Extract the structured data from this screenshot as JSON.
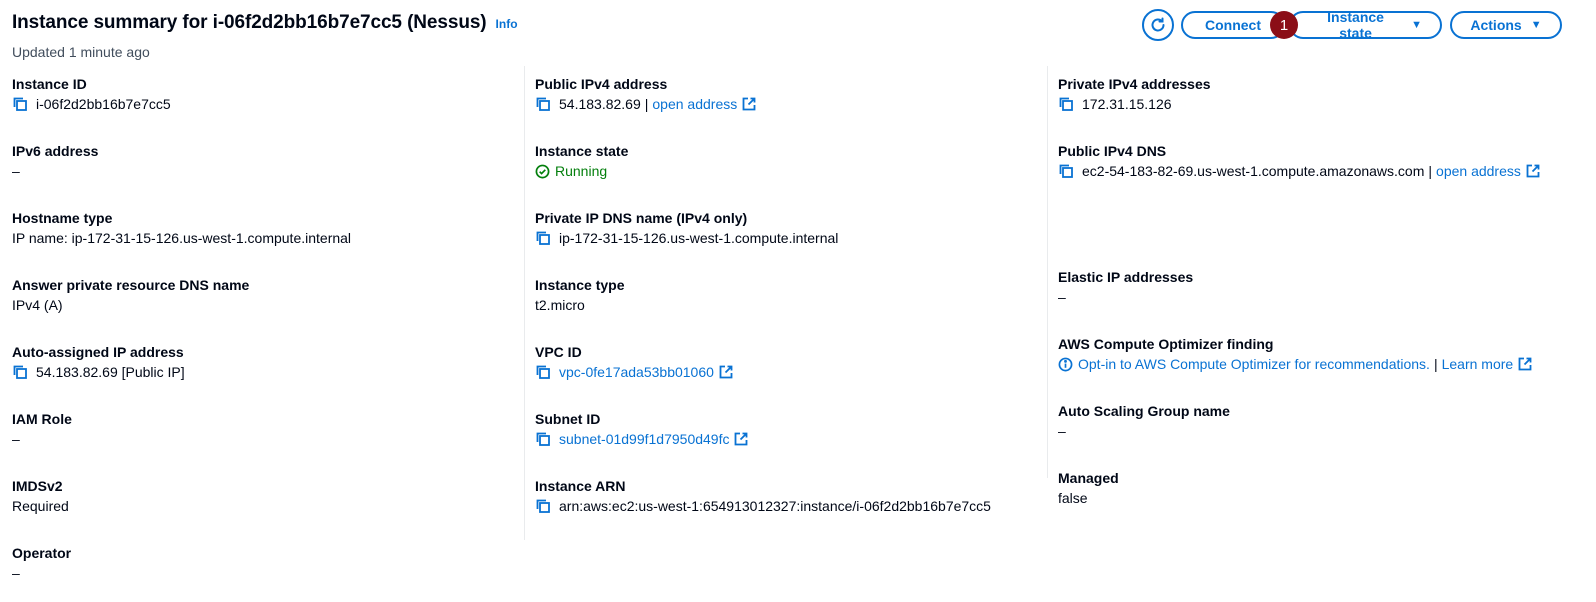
{
  "header": {
    "title": "Instance summary for i-06f2d2bb16b7e7cc5 (Nessus)",
    "info_label": "Info",
    "updated": "Updated 1 minute ago"
  },
  "buttons": {
    "refresh_icon": "refresh-icon",
    "connect": "Connect",
    "badge": "1",
    "instance_state": "Instance state",
    "actions": "Actions"
  },
  "col1": {
    "instance_id_label": "Instance ID",
    "instance_id": "i-06f2d2bb16b7e7cc5",
    "ipv6_label": "IPv6 address",
    "ipv6": "–",
    "hostname_type_label": "Hostname type",
    "hostname_type": "IP name: ip-172-31-15-126.us-west-1.compute.internal",
    "answer_dns_label": "Answer private resource DNS name",
    "answer_dns": "IPv4 (A)",
    "auto_ip_label": "Auto-assigned IP address",
    "auto_ip": "54.183.82.69 [Public IP]",
    "iam_label": "IAM Role",
    "iam": "–",
    "imds_label": "IMDSv2",
    "imds": "Required",
    "operator_label": "Operator",
    "operator": "–"
  },
  "col2": {
    "public_ip_label": "Public IPv4 address",
    "public_ip": "54.183.82.69",
    "pipe": "|",
    "open_address": "open address",
    "state_label": "Instance state",
    "state": "Running",
    "private_dns_label": "Private IP DNS name (IPv4 only)",
    "private_dns": "ip-172-31-15-126.us-west-1.compute.internal",
    "type_label": "Instance type",
    "type": "t2.micro",
    "vpc_label": "VPC ID",
    "vpc": "vpc-0fe17ada53bb01060",
    "subnet_label": "Subnet ID",
    "subnet": "subnet-01d99f1d7950d49fc",
    "arn_label": "Instance ARN",
    "arn": "arn:aws:ec2:us-west-1:654913012327:instance/i-06f2d2bb16b7e7cc5"
  },
  "col3": {
    "private_ip_label": "Private IPv4 addresses",
    "private_ip": "172.31.15.126",
    "public_dns_label": "Public IPv4 DNS",
    "public_dns": "ec2-54-183-82-69.us-west-1.compute.amazonaws.com",
    "pipe": "|",
    "open_address": "open address",
    "elastic_label": "Elastic IP addresses",
    "elastic": "–",
    "optimizer_label": "AWS Compute Optimizer finding",
    "optimizer_link": "Opt-in to AWS Compute Optimizer for recommendations.",
    "learn_more": "Learn more",
    "asg_label": "Auto Scaling Group name",
    "asg": "–",
    "managed_label": "Managed",
    "managed": "false"
  },
  "colors": {
    "link": "#0972d3",
    "success": "#037f0c",
    "badge": "#8b0e17",
    "divider": "#e9ebed"
  }
}
